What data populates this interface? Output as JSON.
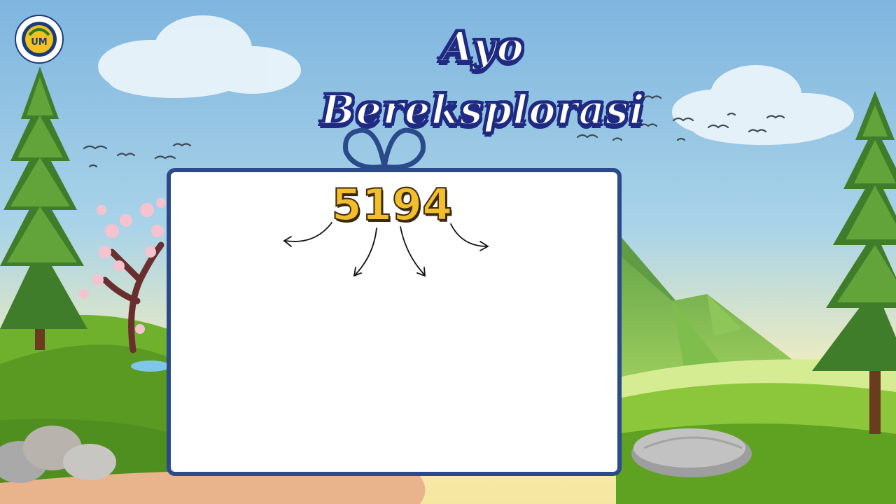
{
  "title": "Ayo Bereksplorasi",
  "logo": {
    "icon": "university-seal-icon",
    "seal_text": "UNIVERSITAS NEGERI MALANG",
    "mark": "UM"
  },
  "board": {
    "number": "5194",
    "arrow_count": 4
  },
  "colors": {
    "title_outline": "#1f2a82",
    "board_border": "#2a4a8a",
    "number_fill": "#f2be2c",
    "sky_top": "#7fb5df",
    "grass": "#7cbb2a"
  }
}
